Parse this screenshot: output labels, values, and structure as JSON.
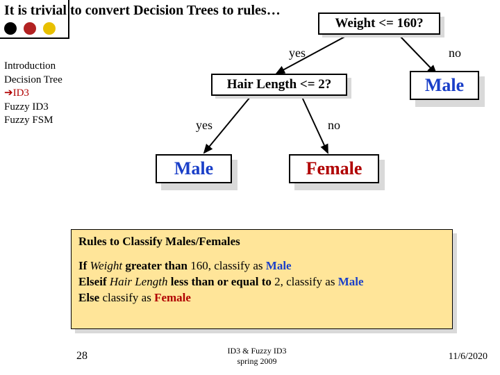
{
  "title": "It is trivial to convert Decision Trees to rules…",
  "nav": {
    "items": [
      "Introduction",
      "Decision Tree",
      "ID3",
      "Fuzzy ID3",
      "Fuzzy FSM"
    ],
    "arrow": "➔"
  },
  "tree": {
    "root": "Weight <= 160?",
    "root_yes": "yes",
    "root_no": "no",
    "right_leaf": "Male",
    "left_node": "Hair Length <= 2?",
    "left_yes": "yes",
    "left_no": "no",
    "ll_leaf": "Male",
    "lr_leaf": "Female"
  },
  "rules": {
    "heading": "Rules to Classify Males/Females",
    "l1a": "If ",
    "l1b": "Weight ",
    "l1c": "greater than ",
    "l1d": "160",
    "l1e": ", classify as ",
    "l1f": "Male",
    "l2a": "Elseif ",
    "l2b": "Hair Length ",
    "l2c": "less than or equal to ",
    "l2d": "2",
    "l2e": ", classify as ",
    "l2f": "Male",
    "l3a": "Else ",
    "l3b": "classify as ",
    "l3c": "Female"
  },
  "footer": {
    "slide": "28",
    "mid1": "ID3 & Fuzzy ID3",
    "mid2": "spring 2009",
    "date": "11/6/2020"
  }
}
